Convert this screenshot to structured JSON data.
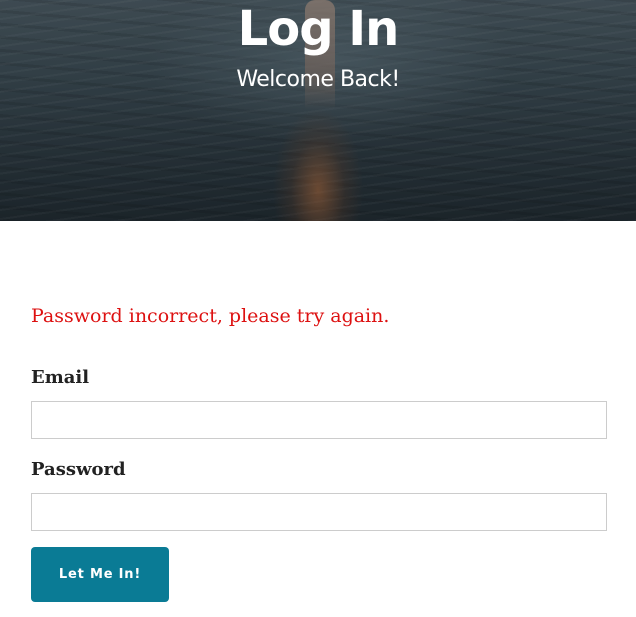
{
  "header": {
    "title": "Log In",
    "subtitle": "Welcome Back!"
  },
  "form": {
    "error_message": "Password incorrect, please try again.",
    "email_label": "Email",
    "email_value": "",
    "password_label": "Password",
    "password_value": "",
    "submit_label": "Let Me In!"
  },
  "colors": {
    "accent": "#0a7b95",
    "error": "#dd1111",
    "label_text": "#222222",
    "input_border": "#cccccc"
  }
}
